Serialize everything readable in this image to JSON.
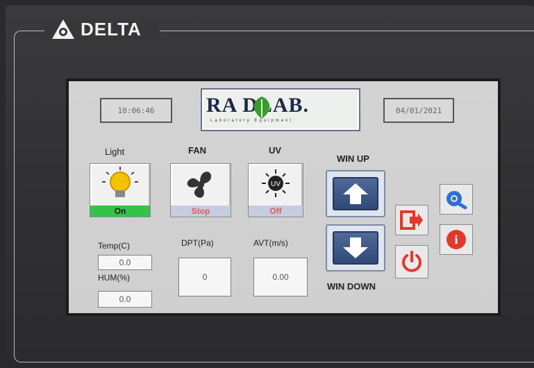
{
  "device": {
    "brand": "DELTA"
  },
  "header": {
    "time": "10:06:46",
    "date": "04/01/2021",
    "logo": {
      "text": "RA DLAB.",
      "subtitle": "Laboratory   Equipment"
    }
  },
  "controls": {
    "light": {
      "label": "Light",
      "status": "On",
      "status_color": "#35c24a"
    },
    "fan": {
      "label": "FAN",
      "status": "Stop",
      "status_color": "#e05a5a"
    },
    "uv": {
      "label": "UV",
      "status": "Off",
      "status_color": "#e05a5a",
      "icon_text": "UV"
    }
  },
  "window": {
    "up_label": "WIN UP",
    "down_label": "WIN DOWN"
  },
  "readings": {
    "temp": {
      "label": "Temp(C)",
      "value": "0.0"
    },
    "hum": {
      "label": "HUM(%)",
      "value": "0.0"
    },
    "dpt": {
      "label": "DPT(Pa)",
      "value": "0"
    },
    "avt": {
      "label": "AVT(m/s)",
      "value": "0.00"
    }
  },
  "icons": {
    "exit": "exit-icon",
    "power": "power-icon",
    "settings": "gear-icon",
    "info": "info-icon"
  },
  "colors": {
    "accent_red": "#e03a2e",
    "accent_blue": "#2f6fd6",
    "arrow_blue": "#2f4a78"
  }
}
